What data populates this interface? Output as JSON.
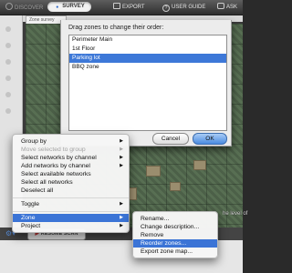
{
  "toolbar": {
    "discover": "DISCOVER",
    "survey": "SURVEY",
    "export": "EXPORT",
    "user_guide": "USER GUIDE",
    "ask": "ASK"
  },
  "map": {
    "zone_tab": "Zone survey",
    "edge_label": "he level of"
  },
  "status": {
    "resume": "RESUME SCAN"
  },
  "dialog": {
    "title": "Drag zones to change their order:",
    "zones": [
      "Perimeter Main",
      "1st Floor",
      "Parking lot",
      "BBQ zone"
    ],
    "selected_index": 2,
    "cancel": "Cancel",
    "ok": "OK"
  },
  "context_menu": {
    "items": [
      {
        "label": "Group by",
        "submenu": true,
        "enabled": true
      },
      {
        "label": "Move selected to group",
        "submenu": true,
        "enabled": false
      },
      {
        "label": "Select networks by channel",
        "submenu": true,
        "enabled": true
      },
      {
        "label": "Add networks by channel",
        "submenu": true,
        "enabled": true
      },
      {
        "label": "Select available networks",
        "submenu": false,
        "enabled": true
      },
      {
        "label": "Select all networks",
        "submenu": false,
        "enabled": true
      },
      {
        "label": "Deselect all",
        "submenu": false,
        "enabled": true
      },
      {
        "label": "Toggle",
        "submenu": true,
        "enabled": true
      },
      {
        "label": "Zone",
        "submenu": true,
        "enabled": true,
        "highlighted": true
      },
      {
        "label": "Project",
        "submenu": true,
        "enabled": true
      }
    ]
  },
  "zone_submenu": {
    "items": [
      "Rename...",
      "Change description...",
      "Remove",
      "Reorder zones...",
      "Export zone map..."
    ],
    "highlighted_index": 3
  },
  "colors": {
    "selection": "#3b74d6",
    "ok_button": "#4a8be0"
  }
}
